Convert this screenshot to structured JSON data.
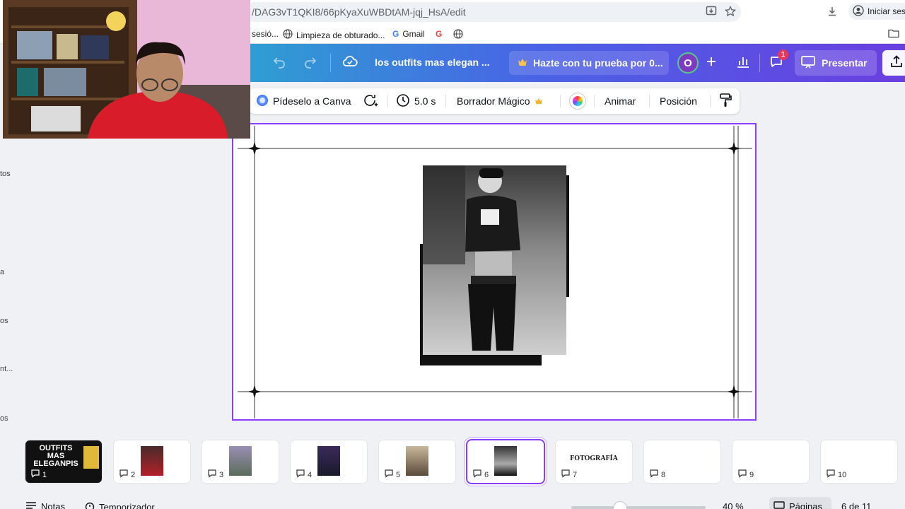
{
  "browser": {
    "url": "/DAG3vT1QKI8/66pKyaXuWBDtAM-jqj_HsA/edit",
    "signin_label": "Iniciar sesi",
    "bookmarks": [
      {
        "label": "sesió...",
        "icon": "none"
      },
      {
        "label": "Limpieza de obturado...",
        "icon": "globe-icon"
      },
      {
        "label": "Gmail",
        "icon": "google-icon"
      },
      {
        "label": "",
        "icon": "google-icon"
      },
      {
        "label": "",
        "icon": "globe-icon"
      }
    ]
  },
  "header": {
    "doc_title": "los outfits mas elegan ...",
    "trial_label": "Hazte con tu prueba por 0...",
    "avatar_initial": "O",
    "comment_badge": "1",
    "present_label": "Presentar"
  },
  "toolbar": {
    "magic_label": "Pídeselo a Canva",
    "duration": "5.0 s",
    "eraser_label": "Borrador Mágico",
    "animate_label": "Animar",
    "position_label": "Posición"
  },
  "left_panel": {
    "labels": [
      "tos",
      "a",
      "os",
      "nt...",
      "os"
    ]
  },
  "pages": [
    {
      "num": "1",
      "title": "OUTFITS MAS ELEGANPIS"
    },
    {
      "num": "2"
    },
    {
      "num": "3"
    },
    {
      "num": "4"
    },
    {
      "num": "5"
    },
    {
      "num": "6"
    },
    {
      "num": "7",
      "title": "FOTOGRAFÍA"
    },
    {
      "num": "8"
    },
    {
      "num": "9"
    },
    {
      "num": "10"
    }
  ],
  "footer": {
    "notes_label": "Notas",
    "timer_label": "Temporizador",
    "zoom": "40 %",
    "pages_label": "Páginas",
    "page_count": "6 de 11"
  },
  "colors": {
    "accent": "#8b3dff",
    "header_start": "#2e9fd2",
    "header_end": "#6a3fe0"
  }
}
